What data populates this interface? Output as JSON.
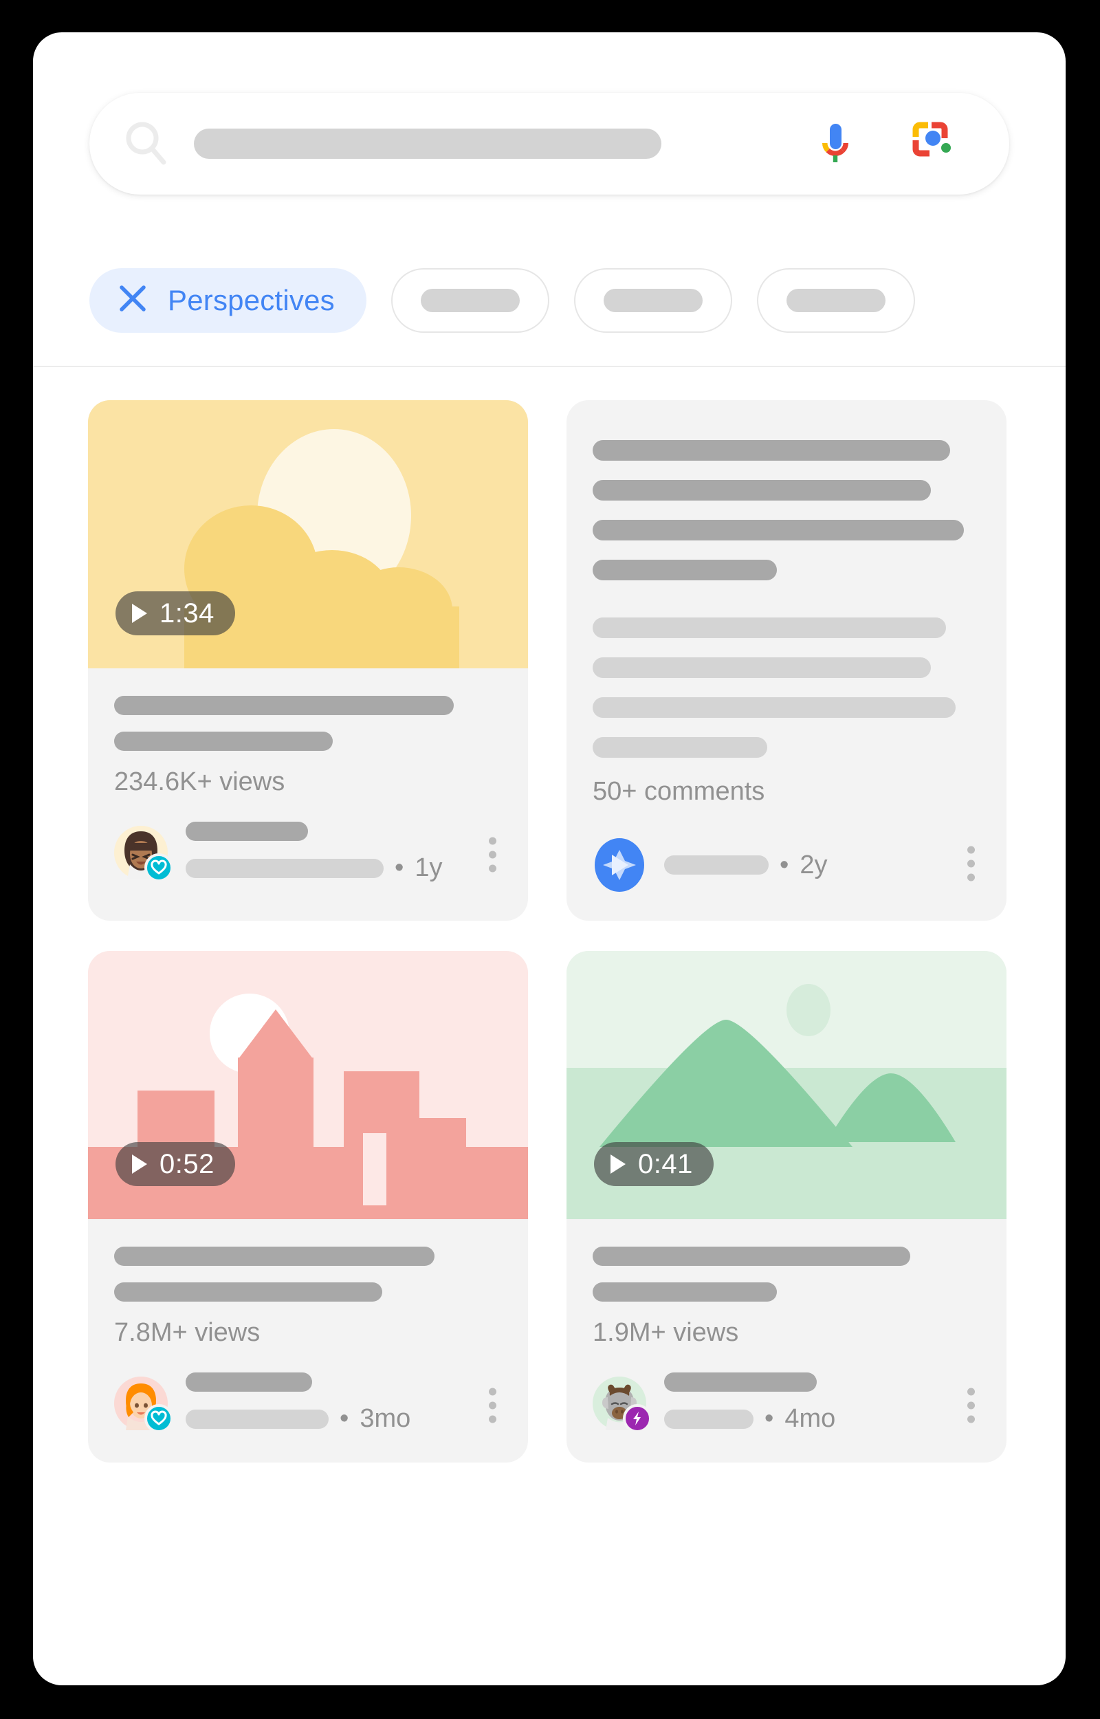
{
  "search": {
    "icon": "search-icon",
    "placeholder": "",
    "mic_icon": "microphone-icon",
    "lens_icon": "google-lens-icon"
  },
  "filters": {
    "active_chip": {
      "label": "Perspectives",
      "icon": "close-icon",
      "accent": "#4285f4",
      "background": "#e8f0fe"
    },
    "placeholder_chips": [
      {
        "label": ""
      },
      {
        "label": ""
      },
      {
        "label": ""
      }
    ]
  },
  "cards": [
    {
      "id": "card-video-sunny",
      "type": "video",
      "thumbnail": "sun-and-clouds-illustration",
      "thumb_colors": {
        "sky": "#fbe3a4",
        "sun": "#fdf6e3",
        "cloud": "#f8d77c"
      },
      "duration": "1:34",
      "stat": "234.6K+ views",
      "timestamp": "1y",
      "separator": "•",
      "avatar": "woman-dark-hair-avatar",
      "avatar_badge": "heart-badge-icon",
      "avatar_badge_color": "#00bcd4",
      "menu": "more-options-icon"
    },
    {
      "id": "card-text-discussion",
      "type": "text",
      "stat": "50+ comments",
      "timestamp": "2y",
      "separator": "•",
      "avatar": "gemini-sparkle-avatar",
      "avatar_color": "#4285f4",
      "menu": "more-options-icon"
    },
    {
      "id": "card-video-city",
      "type": "video",
      "thumbnail": "city-skyline-illustration",
      "thumb_colors": {
        "sky": "#fde8e6",
        "buildings": "#f3a39c",
        "moon": "#ffffff"
      },
      "duration": "0:52",
      "stat": "7.8M+ views",
      "timestamp": "3mo",
      "separator": "•",
      "avatar": "woman-orange-hair-avatar",
      "avatar_badge": "heart-badge-icon",
      "avatar_badge_color": "#00bcd4",
      "menu": "more-options-icon"
    },
    {
      "id": "card-video-mountains",
      "type": "video",
      "thumbnail": "mountain-landscape-illustration",
      "thumb_colors": {
        "sky": "#e8f4ea",
        "ground": "#cae8d2",
        "mountains": "#8bcfa4"
      },
      "duration": "0:41",
      "stat": "1.9M+ views",
      "timestamp": "4mo",
      "separator": "•",
      "avatar": "ox-animal-avatar",
      "avatar_badge": "lightning-badge-icon",
      "avatar_badge_color": "#9c27b0",
      "menu": "more-options-icon"
    }
  ]
}
